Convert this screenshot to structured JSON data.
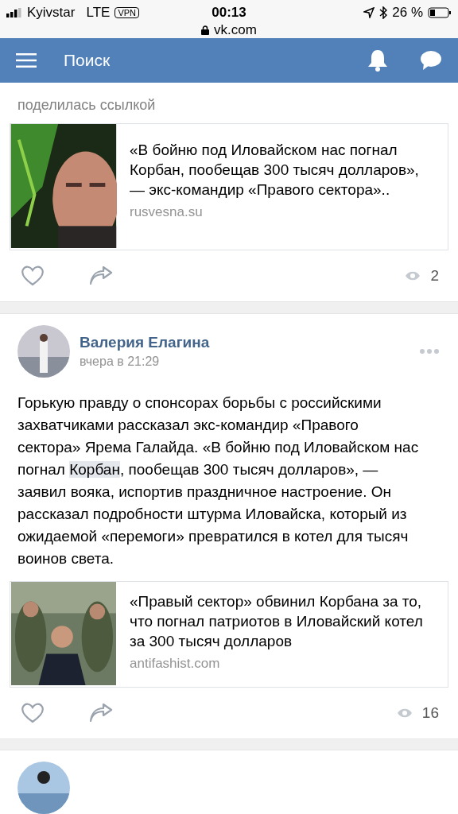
{
  "status_bar": {
    "carrier": "Kyivstar",
    "network": "LTE",
    "vpn": "VPN",
    "time": "00:13",
    "battery": "26 %",
    "url": "vk.com"
  },
  "header": {
    "title": "Поиск"
  },
  "posts": [
    {
      "kind": "continued",
      "action": "поделилась ссылкой",
      "link": {
        "title": "«В бойню под Иловайском нас погнал Корбан, пообещав 300 тысяч долларов», — экс-командир «Правого сектора»..",
        "domain": "rusvesna.su"
      },
      "views": "2"
    },
    {
      "kind": "full",
      "author": "Валерия Елагина",
      "time": "вчера в 21:29",
      "text": [
        {
          "text": "Горькую правду о спонсорах борьбы с российскими захватчиками рассказал экс-командир «Правого сектора» Ярема Галайда. «В бойню под Иловайском нас погнал ",
          "highlighted": false
        },
        {
          "text": "Корбан",
          "highlighted": true
        },
        {
          "text": ", пообещав 300 тысяч долларов», — заявил вояка, испортив праздничное настроение. Он рассказал подробности штурма Иловайска, который из ожидаемой «перемоги» превратился в котел для тысяч воинов света.",
          "highlighted": false
        }
      ],
      "link": {
        "title": "«Правый сектор» обвинил Корбана за то, что погнал патриотов в Иловайский котел за 300 тысяч долларов",
        "domain": "antifashist.com"
      },
      "views": "16"
    },
    {
      "kind": "stub"
    }
  ]
}
